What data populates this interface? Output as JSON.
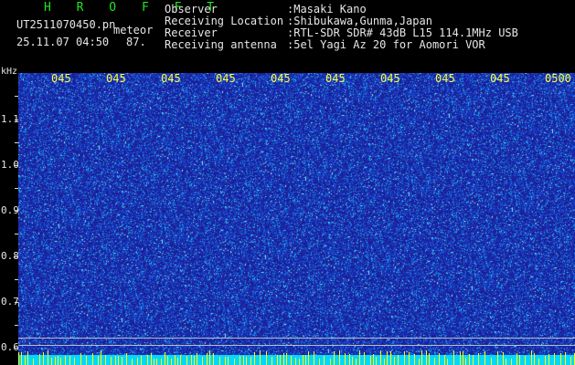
{
  "header": {
    "brand": "H R O F F T",
    "filename": "UT2511070450.pn",
    "mode": "meteor",
    "datetime": "25.11.07 04:50",
    "level": "87."
  },
  "info": [
    {
      "key": "Observer",
      "value": ":Masaki Kano"
    },
    {
      "key": "Receiving Location",
      "value": ":Shibukawa,Gunma,Japan"
    },
    {
      "key": "Receiver",
      "value": ":RTL-SDR SDR# 43dB L15 114.1MHz USB"
    },
    {
      "key": "Receiving antenna",
      "value": ":5el Yagi Az 20 for Aomori VOR"
    }
  ],
  "yaxis": {
    "unit": "kHz",
    "labels": [
      "1.1",
      "1.0",
      "0.9",
      "0.8",
      "0.7",
      "0.6"
    ]
  },
  "time_labels": [
    "045",
    "045",
    "045",
    "045",
    "045",
    "045",
    "045",
    "045",
    "045",
    "0500"
  ],
  "colors": {
    "background": "#000000",
    "spectrogram": "#2323a6",
    "time_labels": "#ffff40",
    "brand": "#1ee81e",
    "bottom_band": "#00d8ff"
  }
}
